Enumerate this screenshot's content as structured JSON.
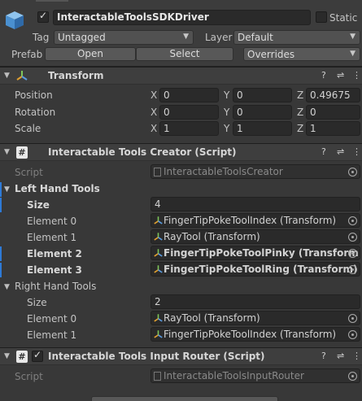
{
  "header": {
    "object_name": "InteractableToolsSDKDriver",
    "active_checked": true,
    "static_label": "Static",
    "tag_label": "Tag",
    "tag_value": "Untagged",
    "layer_label": "Layer",
    "layer_value": "Default",
    "prefab_label": "Prefab",
    "open_label": "Open",
    "select_label": "Select",
    "overrides_label": "Overrides"
  },
  "transform": {
    "title": "Transform",
    "position_label": "Position",
    "rotation_label": "Rotation",
    "scale_label": "Scale",
    "axis_x": "X",
    "axis_y": "Y",
    "axis_z": "Z",
    "position": {
      "x": "0",
      "y": "0",
      "z": "0.49675"
    },
    "rotation": {
      "x": "0",
      "y": "0",
      "z": "0"
    },
    "scale": {
      "x": "1",
      "y": "1",
      "z": "1"
    }
  },
  "creator": {
    "title": "Interactable Tools Creator (Script)",
    "script_label": "Script",
    "script_value": "InteractableToolsCreator",
    "left_label": "Left Hand Tools",
    "left_size_label": "Size",
    "left_size": "4",
    "left_elements": [
      {
        "label": "Element 0",
        "value": "FingerTipPokeToolIndex (Transform)"
      },
      {
        "label": "Element 1",
        "value": "RayTool (Transform)"
      },
      {
        "label": "Element 2",
        "value": "FingerTipPokeToolPinky (Transform)"
      },
      {
        "label": "Element 3",
        "value": "FingerTipPokeToolRing (Transform)"
      }
    ],
    "right_label": "Right Hand Tools",
    "right_size_label": "Size",
    "right_size": "2",
    "right_elements": [
      {
        "label": "Element 0",
        "value": "RayTool (Transform)"
      },
      {
        "label": "Element 1",
        "value": "FingerTipPokeToolIndex (Transform)"
      }
    ]
  },
  "router": {
    "title": "Interactable Tools Input Router (Script)",
    "script_label": "Script",
    "script_value": "InteractableToolsInputRouter"
  },
  "icons": {
    "help": "?",
    "settings": "⇌",
    "menu": "⋮"
  },
  "colors": {
    "background": "#383838",
    "section": "#3e3e3e",
    "field": "#2a2a2a",
    "accent": "#2e7ad6"
  }
}
